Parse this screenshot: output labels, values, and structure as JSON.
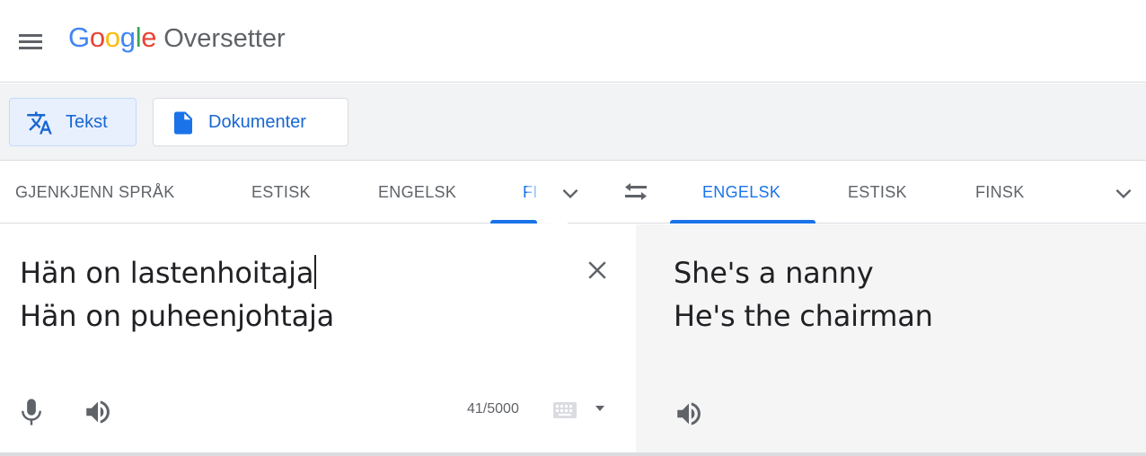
{
  "header": {
    "logo_letters": [
      {
        "ch": "G",
        "color": "#4285F4"
      },
      {
        "ch": "o",
        "color": "#EA4335"
      },
      {
        "ch": "o",
        "color": "#FBBC05"
      },
      {
        "ch": "g",
        "color": "#4285F4"
      },
      {
        "ch": "l",
        "color": "#34A853"
      },
      {
        "ch": "e",
        "color": "#EA4335"
      }
    ],
    "product_name": "Oversetter",
    "menu_icon": "hamburger-menu-icon"
  },
  "modes": {
    "text_label": "Tekst",
    "documents_label": "Dokumenter",
    "text_icon": "translate-icon",
    "documents_icon": "document-icon"
  },
  "source_langs": {
    "detect": "GJENKJENN SPRÅK",
    "tab1": "ESTISK",
    "tab2": "ENGELSK",
    "tab3": "FI",
    "more_icon": "chevron-down-icon"
  },
  "swap_icon": "swap-languages-icon",
  "target_langs": {
    "tab1": "ENGELSK",
    "tab2": "ESTISK",
    "tab3": "FINSK",
    "more_icon": "chevron-down-icon"
  },
  "source": {
    "line1": "Hän on lastenhoitaja",
    "line2": "Hän on puheenjohtaja",
    "char_count": "41/5000",
    "clear_icon": "close-icon",
    "mic_icon": "microphone-icon",
    "speak_icon": "speaker-icon",
    "keyboard_icon": "keyboard-icon"
  },
  "target": {
    "line1": "She's a nanny",
    "line2": "He's the chairman",
    "speak_icon": "speaker-icon"
  },
  "colors": {
    "accent": "#1a73e8",
    "active_mode_bg": "#e8f0fe",
    "target_bg": "#f5f5f5"
  }
}
